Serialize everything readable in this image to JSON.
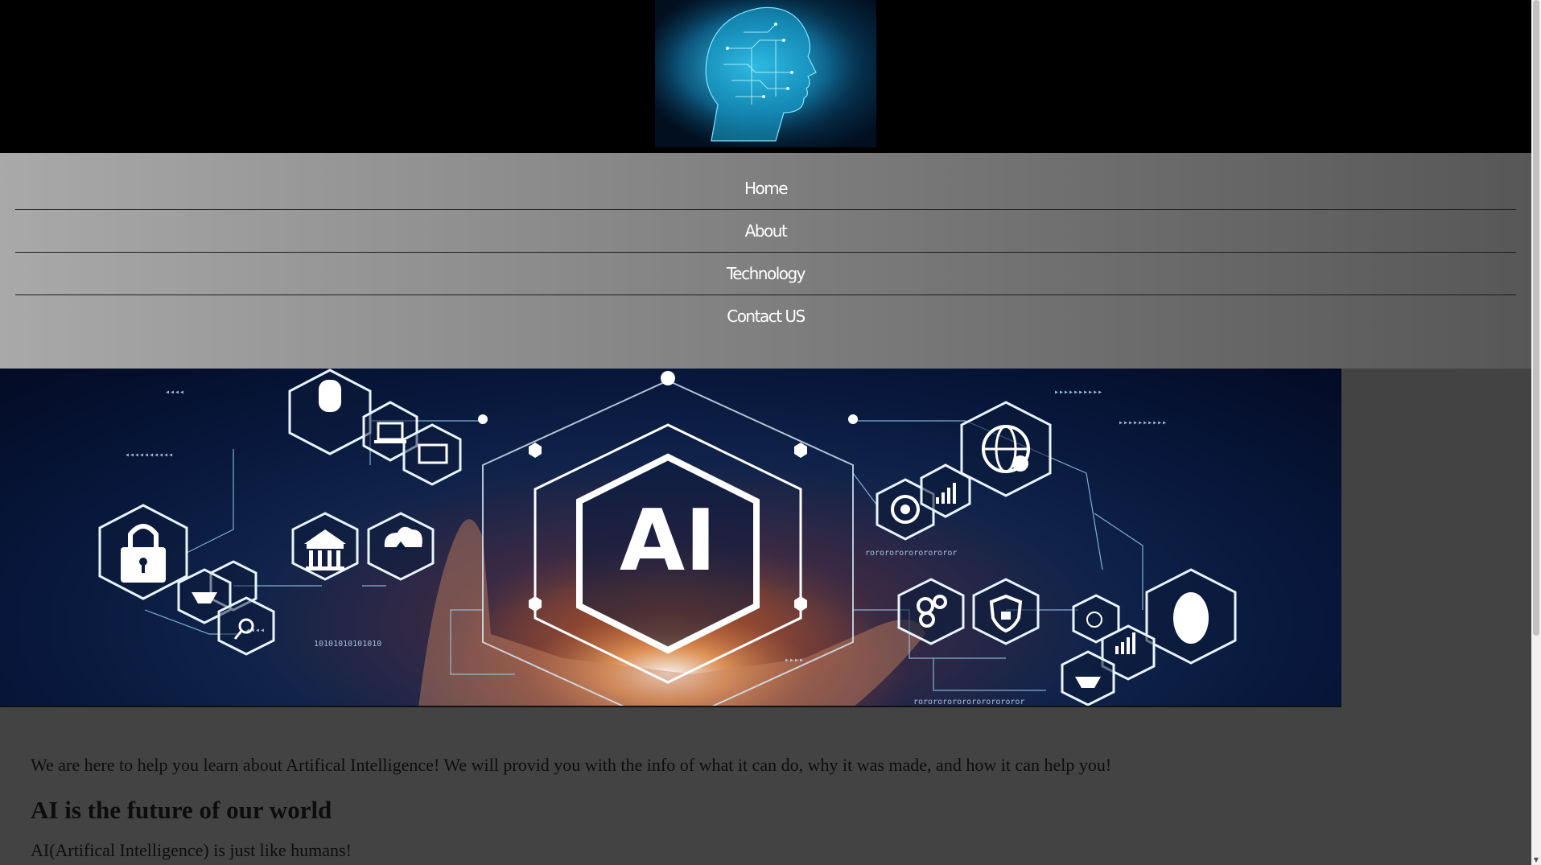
{
  "nav": {
    "items": [
      {
        "label": "Home"
      },
      {
        "label": "About"
      },
      {
        "label": "Technology"
      },
      {
        "label": "Contact US"
      }
    ]
  },
  "banner": {
    "center_text": "AI",
    "icons": [
      "lightbulb-icon",
      "laptop-icon",
      "monitor-chart-icon",
      "padlock-icon",
      "handshake-icon",
      "magnifier-icon",
      "bank-icon",
      "cloud-upload-icon",
      "money-icon",
      "target-icon",
      "bar-chart-icon",
      "globe-gear-icon",
      "gears-icon",
      "shield-lock-icon",
      "dollar-coins-icon",
      "brain-icon"
    ],
    "binary_text_1": "10101010101010",
    "binary_text_2": "rororororororororor",
    "binary_text_3": "rororororororororororor"
  },
  "content": {
    "intro": "We are here to help you learn about Artifical Intelligence! We will provid you with the info of what it can do, why it was made, and how it can help you!",
    "heading": "AI is the future of our world",
    "sub": "AI(Artifical Intelligence) is just like humans!"
  },
  "colors": {
    "header_bg": "#000000",
    "page_bg": "#434343",
    "nav_text": "#ffffff",
    "accent_cyan": "#2fc4ea"
  },
  "scrollbar": {
    "down_arrow": "▼"
  }
}
